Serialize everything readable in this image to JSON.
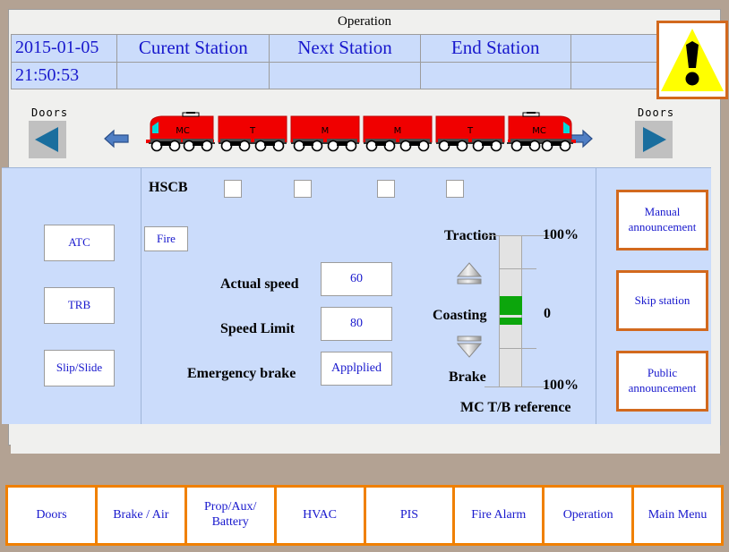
{
  "window": {
    "title": "Operation"
  },
  "header": {
    "date": "2015-01-05",
    "time": "21:50:53",
    "columns": [
      "Curent Station",
      "Next Station",
      "End Station",
      ""
    ],
    "values": [
      "",
      "",
      "",
      ""
    ],
    "warning_icon": "warning-triangle-icon"
  },
  "train": {
    "left_doors_label": "Doors",
    "right_doors_label": "Doors",
    "left_door_icon": "triangle-left-icon",
    "right_door_icon": "triangle-right-icon",
    "left_direction_icon": "arrow-left-icon",
    "right_direction_icon": "arrow-right-icon",
    "cars": [
      "MC",
      "T",
      "M",
      "M",
      "T",
      "MC"
    ],
    "car_color": "#f00000"
  },
  "panel": {
    "left_buttons": [
      {
        "label": "ATC",
        "name": "atc-button"
      },
      {
        "label": "TRB",
        "name": "trb-button"
      },
      {
        "label": "Slip/Slide",
        "name": "slip-slide-button"
      }
    ],
    "hscb": {
      "label": "HSCB",
      "checkboxes": [
        false,
        false,
        false,
        false
      ]
    },
    "fire_button": "Fire",
    "readouts": [
      {
        "label": "Actual speed",
        "value": "60"
      },
      {
        "label": "Speed Limit",
        "value": "80"
      },
      {
        "label": "Emergency brake",
        "value": "Applplied"
      }
    ],
    "gauge": {
      "traction_label": "Traction",
      "coasting_label": "Coasting",
      "brake_label": "Brake",
      "top_pct": "100%",
      "bottom_pct": "100%",
      "current_value": "0",
      "caption": "MC T/B reference",
      "bar_color": "#0ca60c",
      "track_color": "#e3e3e3",
      "up_icon": "triangle-up-icon",
      "down_icon": "triangle-down-icon"
    },
    "right_buttons": [
      {
        "line1": "Manual",
        "line2": "announcement",
        "name": "manual-announcement-button"
      },
      {
        "line1": "Skip station",
        "line2": "",
        "name": "skip-station-button"
      },
      {
        "line1": "Public",
        "line2": "announcement",
        "name": "public-announcement-button"
      }
    ]
  },
  "nav": {
    "tabs": [
      {
        "line1": "Doors",
        "line2": "",
        "name": "nav-tab-doors"
      },
      {
        "line1": "Brake / Air",
        "line2": "",
        "name": "nav-tab-brake-air"
      },
      {
        "line1": "Prop/Aux/",
        "line2": "Battery",
        "name": "nav-tab-prop-aux-battery"
      },
      {
        "line1": "HVAC",
        "line2": "",
        "name": "nav-tab-hvac"
      },
      {
        "line1": "PIS",
        "line2": "",
        "name": "nav-tab-pis"
      },
      {
        "line1": "Fire Alarm",
        "line2": "",
        "name": "nav-tab-fire-alarm"
      },
      {
        "line1": "Operation",
        "line2": "",
        "name": "nav-tab-operation"
      },
      {
        "line1": "Main Menu",
        "line2": "",
        "name": "nav-tab-main-menu"
      }
    ]
  },
  "colors": {
    "panel_blue": "#cbdcfb",
    "accent_orange": "#f08000",
    "warn_yellow": "#ffff00",
    "text_blue": "#1818cd"
  }
}
